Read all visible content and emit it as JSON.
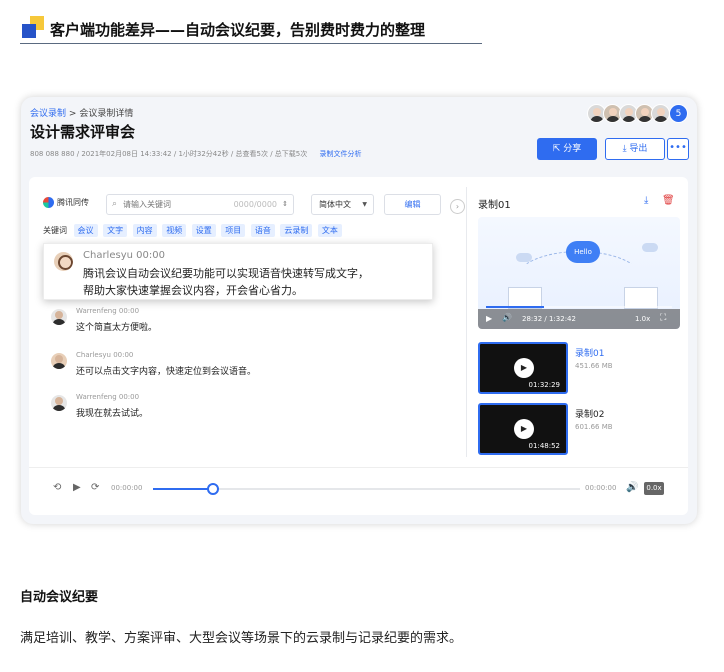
{
  "heading": {
    "text": "客户端功能差异——自动会议纪要，告别费时费力的整理"
  },
  "app": {
    "breadcrumb": {
      "link": "会议录制",
      "sep": ">",
      "current": "会议录制详情"
    },
    "title": "设计需求评审会",
    "meta": "808 088 880 / 2021年02月08日 14:33:42 / 1小时32分42秒 / 总查看5次 / 总下载5次",
    "meta_link": "录制文件分析",
    "participants_count": "5",
    "buttons": {
      "share": "分享",
      "export": "导出",
      "more": "•••"
    },
    "transcript": {
      "brand": "腾讯同传",
      "search_placeholder": "请输入关键词",
      "search_count": "0000/0000",
      "language": "简体中文",
      "edit_label": "编辑",
      "keywords_label": "关键词",
      "keywords": [
        "会议",
        "文字",
        "内容",
        "视频",
        "设置",
        "项目",
        "语音",
        "云录制",
        "文本"
      ],
      "highlight": {
        "speaker": "Charlesyu 00:00",
        "line1": "腾讯会议自动会议纪要功能可以实现语音快速转写成文字，",
        "line2": "帮助大家快速掌握会议内容，开会省心省力。"
      },
      "messages": [
        {
          "speaker": "Warrenfeng 00:00",
          "text": "这个简直太方便啦。"
        },
        {
          "speaker": "Charlesyu 00:00",
          "text": "还可以点击文字内容，快速定位到会议语音。"
        },
        {
          "speaker": "Warrenfeng 00:00",
          "text": "我现在就去试试。"
        }
      ]
    },
    "recordings": {
      "current_title": "录制01",
      "player": {
        "cloud_label": "Hello",
        "time": "28:32 / 1:32:42",
        "speed": "1.0x",
        "progress": 0.31
      },
      "items": [
        {
          "name": "录制01",
          "size": "451.66 MB",
          "duration": "01:32:29"
        },
        {
          "name": "录制02",
          "size": "601.66 MB",
          "duration": "01:48:52"
        }
      ]
    },
    "audio": {
      "time_start": "00:00:00",
      "time_end": "00:00:00",
      "speed": "0.0x",
      "progress": 0.14
    }
  },
  "section": {
    "title": "自动会议纪要",
    "desc": "满足培训、教学、方案评审、大型会议等场景下的云录制与记录纪要的需求。"
  }
}
